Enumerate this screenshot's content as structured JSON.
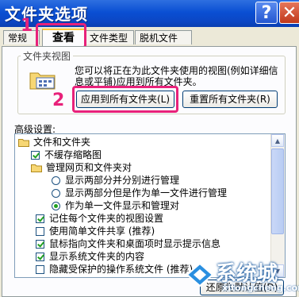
{
  "window": {
    "title": "文件夹选项",
    "help_glyph": "?",
    "close_glyph": "✕"
  },
  "tabs": [
    {
      "label": "常规"
    },
    {
      "label": "查看"
    },
    {
      "label": "文件类型"
    },
    {
      "label": "脱机文件"
    }
  ],
  "annotations": {
    "step1": "1",
    "step2": "2",
    "accent_color": "#e8217a"
  },
  "folder_views": {
    "group_title": "文件夹视图",
    "description": "您可以将正在为此文件夹使用的视图(例如详细信息或平铺)应用到所有文件夹。",
    "apply_button": "应用到所有文件夹(L)",
    "reset_button": "重置所有文件夹(R)"
  },
  "advanced": {
    "label": "高级设置:",
    "items": [
      {
        "type": "folder",
        "text": "文件和文件夹"
      },
      {
        "type": "checkbox",
        "checked": true,
        "text": "不缓存缩略图"
      },
      {
        "type": "folder",
        "text": "管理网页和文件夹对"
      },
      {
        "type": "radio",
        "checked": false,
        "text": "显示两部分并分别进行管理"
      },
      {
        "type": "radio",
        "checked": false,
        "text": "显示两部分但是作为单一文件进行管理"
      },
      {
        "type": "radio",
        "checked": true,
        "text": "作为单一文件显示和管理对"
      },
      {
        "type": "checkbox",
        "checked": true,
        "text": "记住每个文件夹的视图设置"
      },
      {
        "type": "checkbox",
        "checked": false,
        "text": "使用简单文件共享 (推荐)"
      },
      {
        "type": "checkbox",
        "checked": true,
        "text": "鼠标指向文件夹和桌面项时显示提示信息"
      },
      {
        "type": "checkbox",
        "checked": true,
        "text": "显示系统文件夹的内容"
      },
      {
        "type": "checkbox",
        "checked": false,
        "text": "隐藏受保护的操作系统文件 (推荐)"
      }
    ],
    "scroll_up_glyph": "▲",
    "scroll_down_glyph": "▼"
  },
  "restore_button": "还原为默认值(D)",
  "watermark": {
    "brand": "系统城",
    "url": "xitongcheng.com"
  }
}
